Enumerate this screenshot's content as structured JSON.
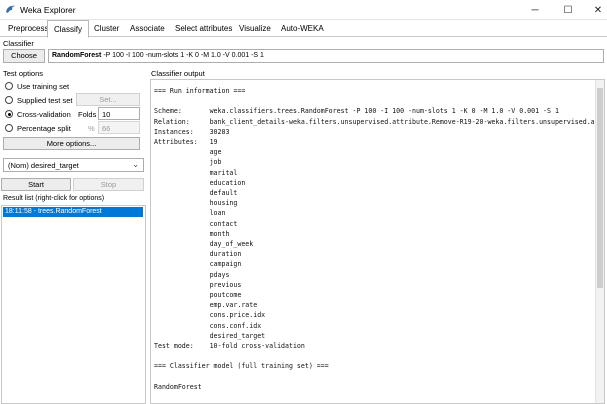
{
  "window": {
    "title": "Weka Explorer",
    "minimize": "─",
    "maximize": "☐",
    "close": "✕"
  },
  "tabs": [
    "Preprocess",
    "Classify",
    "Cluster",
    "Associate",
    "Select attributes",
    "Visualize",
    "Auto-WEKA"
  ],
  "active_tab": "Classify",
  "classifier": {
    "section_label": "Classifier",
    "choose_label": "Choose",
    "scheme_name": "RandomForest",
    "scheme_args": " -P 100 -I 100 -num-slots 1 -K 0 -M 1.0 -V 0.001 -S 1"
  },
  "test_options": {
    "section_label": "Test options",
    "use_training": "Use training set",
    "supplied_test": "Supplied test set",
    "set_button": "Set...",
    "cross_validation": "Cross-validation",
    "folds_label": "Folds",
    "folds_value": "10",
    "percentage_split": "Percentage split",
    "percent_sign": "%",
    "percent_value": "66",
    "more_options": "More options..."
  },
  "target": {
    "selected": "(Nom) desired_target",
    "chevron": "⌄"
  },
  "actions": {
    "start": "Start",
    "stop": "Stop"
  },
  "result_list": {
    "label": "Result list (right-click for options)",
    "items": [
      "18:11:58 - trees.RandomForest"
    ]
  },
  "output": {
    "label": "Classifier output",
    "text": "=== Run information ===\n\nScheme:       weka.classifiers.trees.RandomForest -P 100 -I 100 -num-slots 1 -K 0 -M 1.0 -V 0.001 -S 1\nRelation:     bank_client_details-weka.filters.unsupervised.attribute.Remove-R19-20-weka.filters.unsupervised.attribute\nInstances:    30283\nAttributes:   19\n              age\n              job\n              marital\n              education\n              default\n              housing\n              loan\n              contact\n              month\n              day_of_week\n              duration\n              campaign\n              pdays\n              previous\n              poutcome\n              emp.var.rate\n              cons.price.idx\n              cons.conf.idx\n              desired_target\nTest mode:    10-fold cross-validation\n\n=== Classifier model (full training set) ===\n\nRandomForest"
  }
}
